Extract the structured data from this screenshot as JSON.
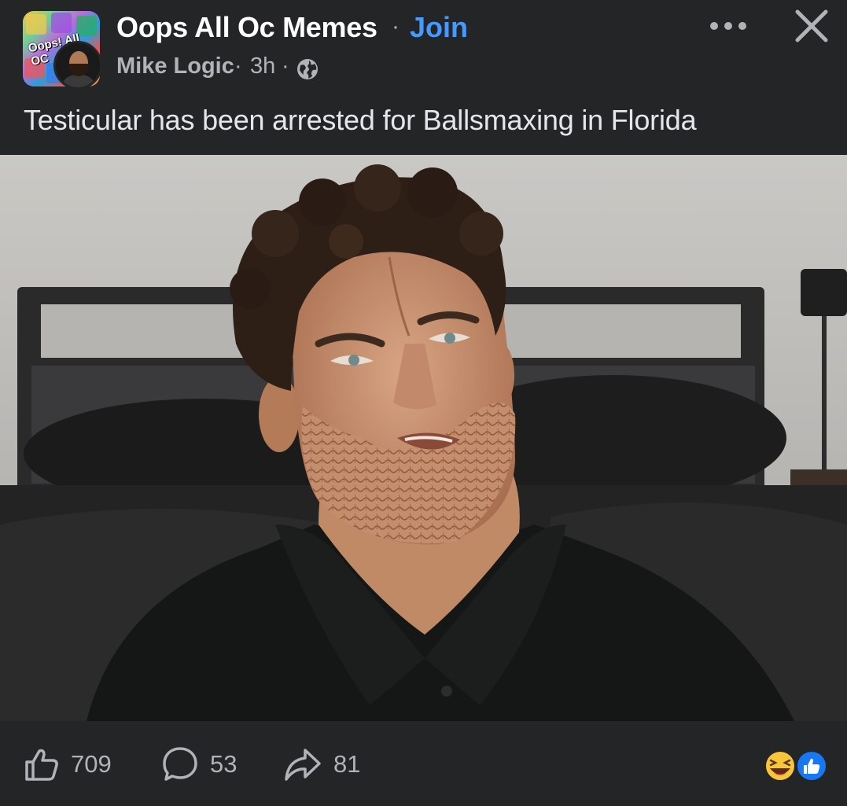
{
  "post": {
    "group_name": "Oops All Oc Memes",
    "separator": "·",
    "join_label": "Join",
    "author": "Mike Logic",
    "time": "3h",
    "group_logo_text": "Oops! All OC",
    "text": "Testicular has been arrested for Ballsmaxing in Florida"
  },
  "actions": {
    "likes": "709",
    "comments": "53",
    "shares": "81"
  },
  "icons": {
    "more": "more-horizontal-icon",
    "close": "close-icon",
    "privacy": "globe-icon",
    "like": "thumbs-up-icon",
    "comment": "comment-bubble-icon",
    "share": "share-arrow-icon",
    "reaction1": "haha-emoji-icon",
    "reaction2": "like-reaction-icon"
  },
  "colors": {
    "background": "#242526",
    "accent": "#4599ff",
    "secondary_text": "#b0b3b8",
    "primary_text": "#e4e6eb"
  }
}
